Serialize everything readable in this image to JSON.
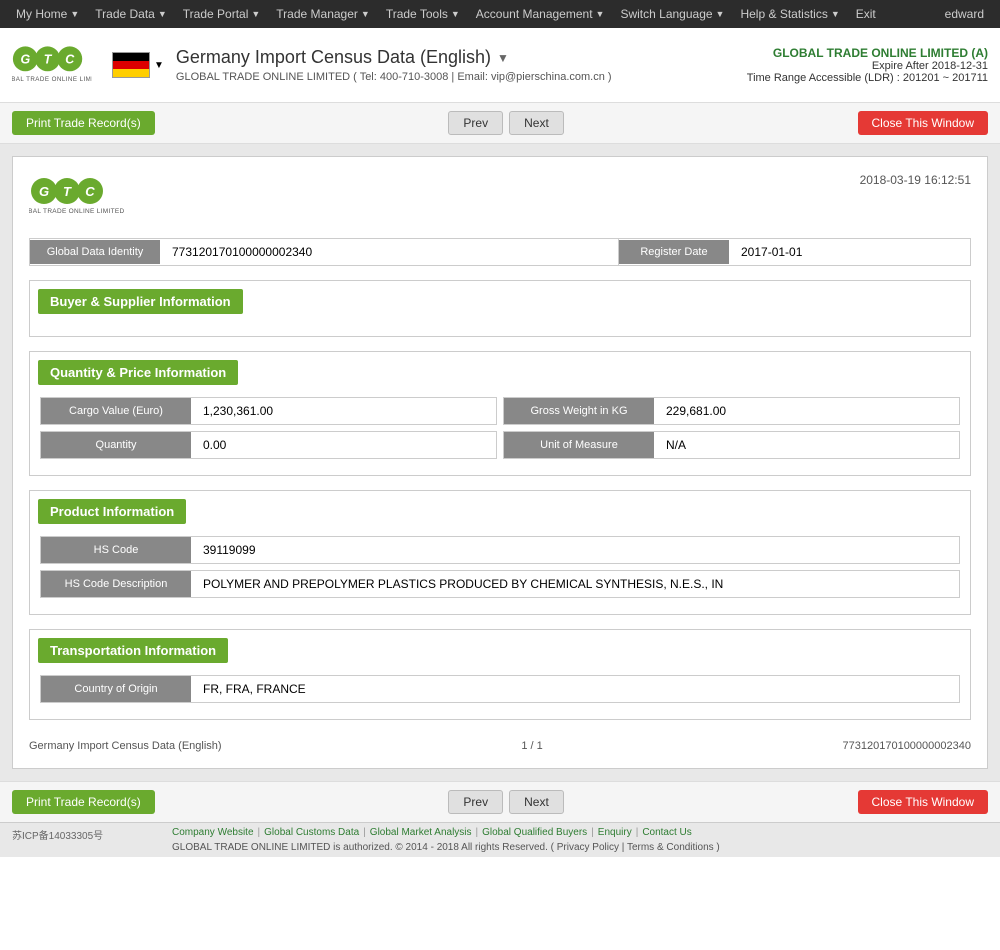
{
  "nav": {
    "items": [
      {
        "label": "My Home",
        "arrow": true
      },
      {
        "label": "Trade Data",
        "arrow": true
      },
      {
        "label": "Trade Portal",
        "arrow": true
      },
      {
        "label": "Trade Manager",
        "arrow": true
      },
      {
        "label": "Trade Tools",
        "arrow": true
      },
      {
        "label": "Account Management",
        "arrow": true
      },
      {
        "label": "Switch Language",
        "arrow": true
      },
      {
        "label": "Help & Statistics",
        "arrow": true
      },
      {
        "label": "Exit",
        "arrow": false
      }
    ],
    "user": "edward"
  },
  "header": {
    "title": "Germany Import Census Data (English)",
    "subtitle": "GLOBAL TRADE ONLINE LIMITED ( Tel: 400-710-3008 | Email: vip@pierschina.com.cn )",
    "company_name": "GLOBAL TRADE ONLINE LIMITED (A)",
    "expire": "Expire After 2018-12-31",
    "time_range": "Time Range Accessible (LDR) : 201201 ~ 201711"
  },
  "toolbar": {
    "print_label": "Print Trade Record(s)",
    "prev_label": "Prev",
    "next_label": "Next",
    "close_label": "Close This Window"
  },
  "record": {
    "timestamp": "2018-03-19 16:12:51",
    "global_data_identity_label": "Global Data Identity",
    "global_data_identity_value": "773120170100000002340",
    "register_date_label": "Register Date",
    "register_date_value": "2017-01-01",
    "buyer_supplier_section": "Buyer & Supplier Information",
    "quantity_price_section": "Quantity & Price Information",
    "cargo_value_label": "Cargo Value (Euro)",
    "cargo_value": "1,230,361.00",
    "gross_weight_label": "Gross Weight in KG",
    "gross_weight": "229,681.00",
    "quantity_label": "Quantity",
    "quantity_value": "0.00",
    "unit_of_measure_label": "Unit of Measure",
    "unit_of_measure_value": "N/A",
    "product_section": "Product Information",
    "hs_code_label": "HS Code",
    "hs_code_value": "39119099",
    "hs_desc_label": "HS Code Description",
    "hs_desc_value": "POLYMER AND PREPOLYMER PLASTICS PRODUCED BY CHEMICAL SYNTHESIS, N.E.S., IN",
    "transport_section": "Transportation Information",
    "country_origin_label": "Country of Origin",
    "country_origin_value": "FR, FRA, FRANCE",
    "footer_title": "Germany Import Census Data (English)",
    "footer_page": "1 / 1",
    "footer_id": "773120170100000002340"
  },
  "footer": {
    "icp": "苏ICP备14033305号",
    "links": [
      "Company Website",
      "Global Customs Data",
      "Global Market Analysis",
      "Global Qualified Buyers",
      "Enquiry",
      "Contact Us"
    ],
    "copyright": "GLOBAL TRADE ONLINE LIMITED is authorized. © 2014 - 2018 All rights Reserved.  (  Privacy Policy | Terms & Conditions  )"
  }
}
